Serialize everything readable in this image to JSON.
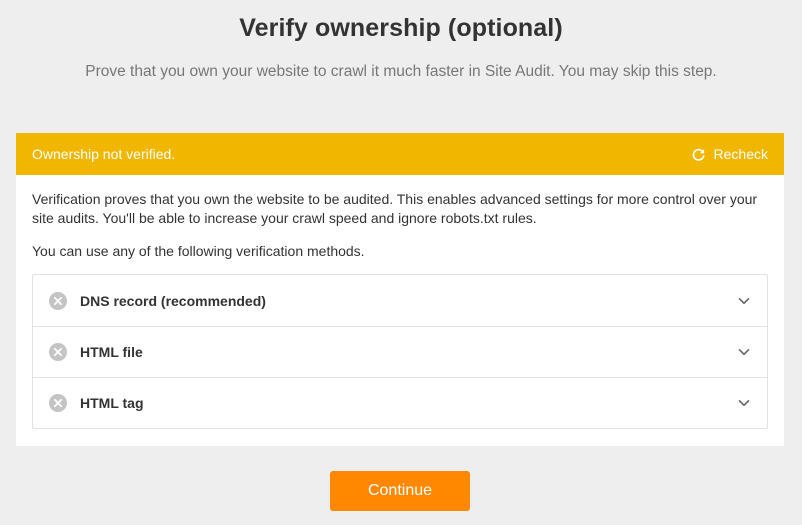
{
  "header": {
    "title": "Verify ownership (optional)",
    "subtitle": "Prove that you own your website to crawl it much faster in Site Audit. You may skip this step."
  },
  "banner": {
    "status_text": "Ownership not verified.",
    "recheck_label": "Recheck",
    "recheck_icon": "refresh-icon",
    "color": "#f1b600"
  },
  "content": {
    "description": "Verification proves that you own the website to be audited. This enables advanced settings for more control over your site audits. You'll be able to increase your crawl speed and ignore robots.txt rules.",
    "methods_intro": "You can use any of the following verification methods.",
    "methods": [
      {
        "label": "DNS record (recommended)",
        "status_icon": "not-verified-x-icon",
        "expand_icon": "chevron-down-icon"
      },
      {
        "label": "HTML file",
        "status_icon": "not-verified-x-icon",
        "expand_icon": "chevron-down-icon"
      },
      {
        "label": "HTML tag",
        "status_icon": "not-verified-x-icon",
        "expand_icon": "chevron-down-icon"
      }
    ]
  },
  "footer": {
    "continue_label": "Continue",
    "accent_color": "#ff8800"
  }
}
